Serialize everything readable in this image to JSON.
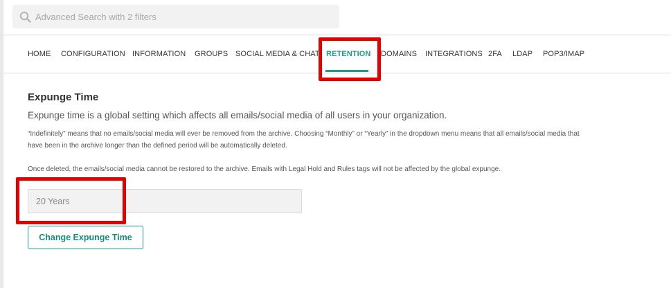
{
  "search": {
    "placeholder": "Advanced Search with 2 filters",
    "icon": "search-icon"
  },
  "nav": {
    "items": [
      {
        "label": "HOME",
        "active": false
      },
      {
        "label": "CONFIGURATION",
        "active": false
      },
      {
        "label": "INFORMATION",
        "active": false
      },
      {
        "label": "GROUPS",
        "active": false
      },
      {
        "label": "SOCIAL MEDIA & CHAT",
        "active": false
      },
      {
        "label": "RETENTION",
        "active": true
      },
      {
        "label": "DOMAINS",
        "active": false
      },
      {
        "label": "INTEGRATIONS",
        "active": false
      },
      {
        "label": "2FA",
        "active": false
      },
      {
        "label": "LDAP",
        "active": false
      },
      {
        "label": "POP3/IMAP",
        "active": false
      }
    ]
  },
  "content": {
    "title": "Expunge Time",
    "lead": "Expunge time is a global setting which affects all emails/social media of all users in your organization.",
    "paragraph1": "“Indefinitely” means that no emails/social media will ever be removed from the archive. Choosing “Monthly” or “Yearly” in the dropdown menu means that all emails/social media that have been in the archive longer than the defined period will be automatically deleted.",
    "paragraph2": "Once deleted, the emails/social media cannot be restored to the archive. Emails with Legal Hold and Rules tags will not be affected by the global expunge.",
    "expunge_value": "20 Years",
    "button_label": "Change Expunge Time"
  },
  "colors": {
    "accent": "#1a9c8f",
    "highlight": "#e50000"
  }
}
